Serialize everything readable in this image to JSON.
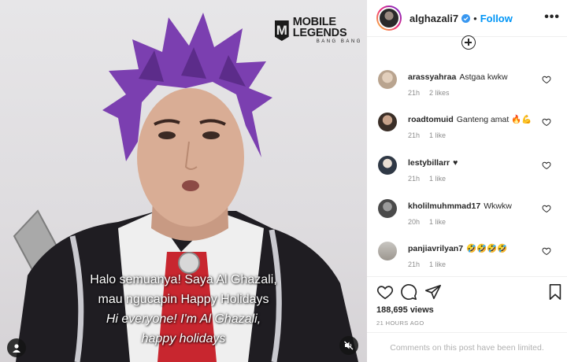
{
  "media": {
    "logo": {
      "main": "MOBILE LEGENDS",
      "sub": "BANG BANG"
    },
    "subtitles": {
      "line1": "Halo semuanya! Saya Al Ghazali,",
      "line2": "mau ngucapin Happy Holidays",
      "line3": "Hi everyone! I'm  Al Ghazali,",
      "line4": "happy holidays"
    },
    "icons": {
      "user": "user-tag-icon",
      "mute": "speaker-muted-icon"
    }
  },
  "post": {
    "username": "alghazali7",
    "separator": "•",
    "follow_label": "Follow",
    "more_label": "•••",
    "views": "188,695 views",
    "time_ago": "21 HOURS AGO",
    "comments_limited": "Comments on this post have been limited."
  },
  "comments": [
    {
      "user": "arassyahraa",
      "text": "Astgaa kwkw",
      "time": "21h",
      "likes": "2 likes",
      "avatar_color": "#b9a48f"
    },
    {
      "user": "roadtomuid",
      "text": "Ganteng amat 🔥💪",
      "time": "21h",
      "likes": "1 like",
      "avatar_color": "#5a4a3e"
    },
    {
      "user": "lestybillarr",
      "text": "♥",
      "time": "21h",
      "likes": "1 like",
      "avatar_color": "#3b4656"
    },
    {
      "user": "kholilmuhmmad17",
      "text": "Wkwkw",
      "time": "20h",
      "likes": "1 like",
      "avatar_color": "#6d6d6d"
    },
    {
      "user": "panjiavrilyan7",
      "text": "🤣🤣🤣🤣",
      "time": "21h",
      "likes": "1 like",
      "avatar_color": "#a7a39d"
    }
  ],
  "colors": {
    "accent": "#0095f6",
    "text": "#262626",
    "muted": "#8e8e8e",
    "hair": "#7b3fb0"
  }
}
